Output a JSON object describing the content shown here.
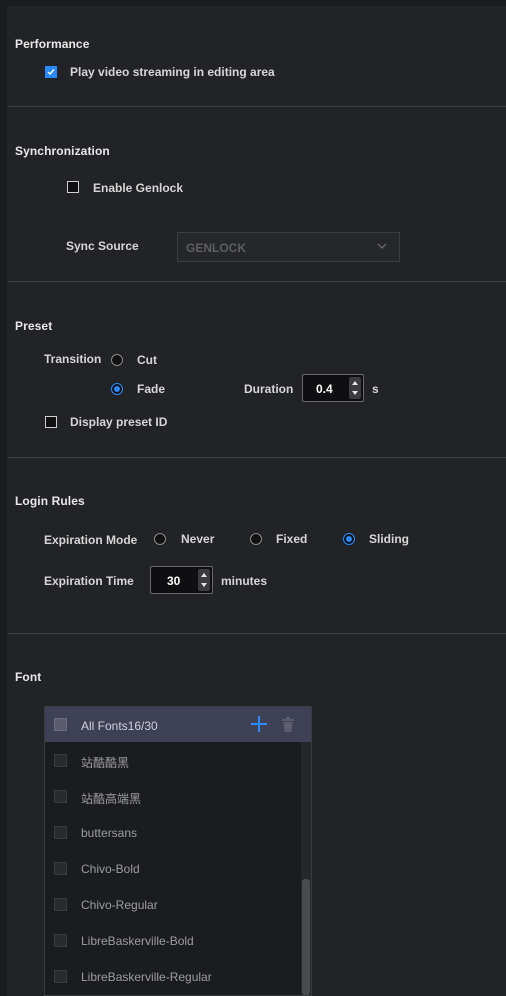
{
  "performance": {
    "title": "Performance",
    "play_video_label": "Play video streaming in editing area",
    "play_video_checked": true
  },
  "synchronization": {
    "title": "Synchronization",
    "enable_genlock_label": "Enable Genlock",
    "enable_genlock_checked": false,
    "sync_source_label": "Sync Source",
    "sync_source_value": "GENLOCK"
  },
  "preset": {
    "title": "Preset",
    "transition_label": "Transition",
    "options": [
      "Cut",
      "Fade"
    ],
    "selected": "Fade",
    "duration_label": "Duration",
    "duration_value": "0.4",
    "duration_unit": "s",
    "display_preset_id_label": "Display preset ID",
    "display_preset_id_checked": false
  },
  "login_rules": {
    "title": "Login Rules",
    "expiration_mode_label": "Expiration Mode",
    "modes": [
      "Never",
      "Fixed",
      "Sliding"
    ],
    "selected_mode": "Sliding",
    "expiration_time_label": "Expiration Time",
    "expiration_time_value": "30",
    "expiration_time_unit": "minutes"
  },
  "font": {
    "title": "Font",
    "header_label": "All Fonts16/30",
    "items": [
      "站酷酷黑",
      "站酷高端黑",
      "buttersans",
      "Chivo-Bold",
      "Chivo-Regular",
      "LibreBaskerville-Bold",
      "LibreBaskerville-Regular"
    ]
  },
  "colors": {
    "accent": "#2b89ff",
    "background": "#222326",
    "list_header": "#3e4055"
  },
  "icons": [
    "checkmark-icon",
    "chevron-down-icon",
    "spin-up-icon",
    "spin-down-icon",
    "plus-icon",
    "trash-icon"
  ]
}
